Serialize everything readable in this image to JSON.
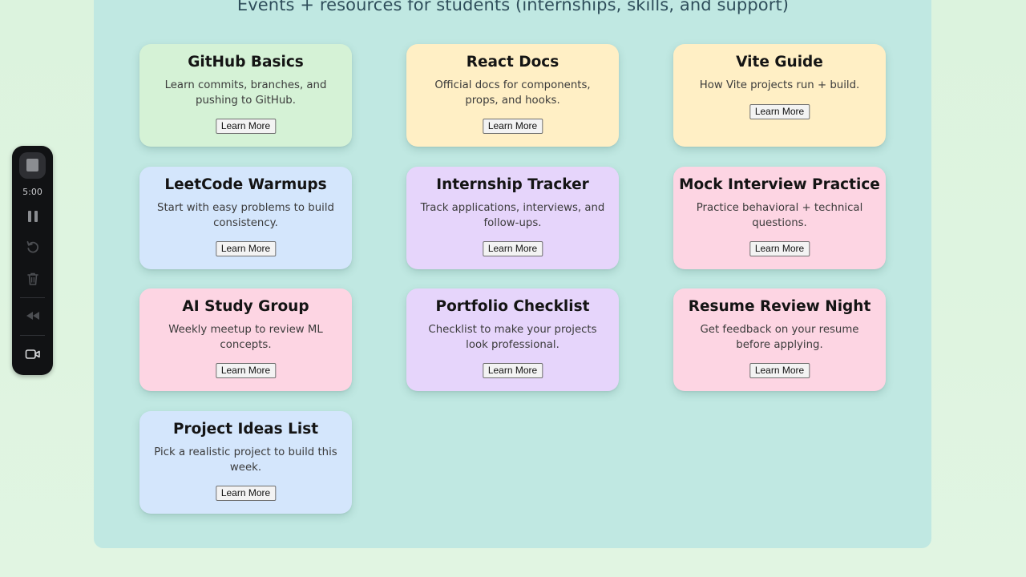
{
  "header": {
    "subtitle": "Events + resources for students (internships, skills, and support)"
  },
  "colors": {
    "green": "#d5f2d6",
    "yellow": "#ffefc5",
    "blue": "#d4e6fc",
    "purple": "#e6d5fb",
    "pink": "#fdd5e3",
    "panel": "#c0e8e2",
    "page_background": "#ddf3df"
  },
  "cards": [
    {
      "title": "GitHub Basics",
      "description": "Learn commits, branches, and pushing to GitHub.",
      "button": "Learn More"
    },
    {
      "title": "React Docs",
      "description": "Official docs for components, props, and hooks.",
      "button": "Learn More"
    },
    {
      "title": "Vite Guide",
      "description": "How Vite projects run + build.",
      "button": "Learn More"
    },
    {
      "title": "LeetCode Warmups",
      "description": "Start with easy problems to build consistency.",
      "button": "Learn More"
    },
    {
      "title": "Internship Tracker",
      "description": "Track applications, interviews, and follow-ups.",
      "button": "Learn More"
    },
    {
      "title": "Mock Interview Practice",
      "description": "Practice behavioral + technical questions.",
      "button": "Learn More"
    },
    {
      "title": "AI Study Group",
      "description": "Weekly meetup to review ML concepts.",
      "button": "Learn More"
    },
    {
      "title": "Portfolio Checklist",
      "description": "Checklist to make your projects look professional.",
      "button": "Learn More"
    },
    {
      "title": "Resume Review Night",
      "description": "Get feedback on your resume before applying.",
      "button": "Learn More"
    },
    {
      "title": "Project Ideas List",
      "description": "Pick a realistic project to build this week.",
      "button": "Learn More"
    }
  ],
  "recorder": {
    "timer": "5:00",
    "icons": [
      "stop-icon",
      "pause-icon",
      "restart-icon",
      "trash-icon",
      "rewind-icon",
      "camera-icon"
    ]
  }
}
